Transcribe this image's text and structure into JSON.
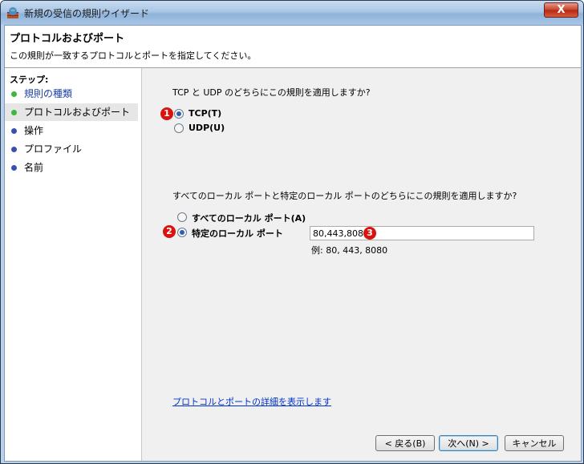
{
  "window": {
    "title": "新規の受信の規則ウイザード",
    "close_label": "X"
  },
  "header": {
    "title": "プロトコルおよびポート",
    "description": "この規則が一致するプロトコルとポートを指定してください。"
  },
  "sidebar": {
    "steps_label": "ステップ:",
    "items": [
      {
        "label": "規則の種類",
        "status": "done"
      },
      {
        "label": "プロトコルおよびポート",
        "status": "current"
      },
      {
        "label": "操作",
        "status": "pending"
      },
      {
        "label": "プロファイル",
        "status": "pending"
      },
      {
        "label": "名前",
        "status": "pending"
      }
    ]
  },
  "protocol": {
    "question": "TCP と UDP のどちらにこの規則を適用しますか?",
    "options": [
      {
        "label": "TCP(T)",
        "selected": true
      },
      {
        "label": "UDP(U)",
        "selected": false
      }
    ]
  },
  "ports": {
    "question": "すべてのローカル ポートと特定のローカル ポートのどちらにこの規則を適用しますか?",
    "options": [
      {
        "label": "すべてのローカル ポート(A)",
        "selected": false
      },
      {
        "label": "特定のローカル ポート",
        "selected": true
      }
    ],
    "input_value": "80,443,8080",
    "example": "例: 80, 443, 8080"
  },
  "badges": [
    "1",
    "2",
    "3"
  ],
  "link": "プロトコルとポートの詳細を表示します",
  "buttons": {
    "back": "< 戻る(B)",
    "next": "次へ(N) >",
    "cancel": "キャンセル"
  },
  "colors": {
    "step_done": "#3cb83c",
    "step_pending": "#3a4fb0",
    "badge": "#d9140f",
    "link": "#0033cc"
  }
}
